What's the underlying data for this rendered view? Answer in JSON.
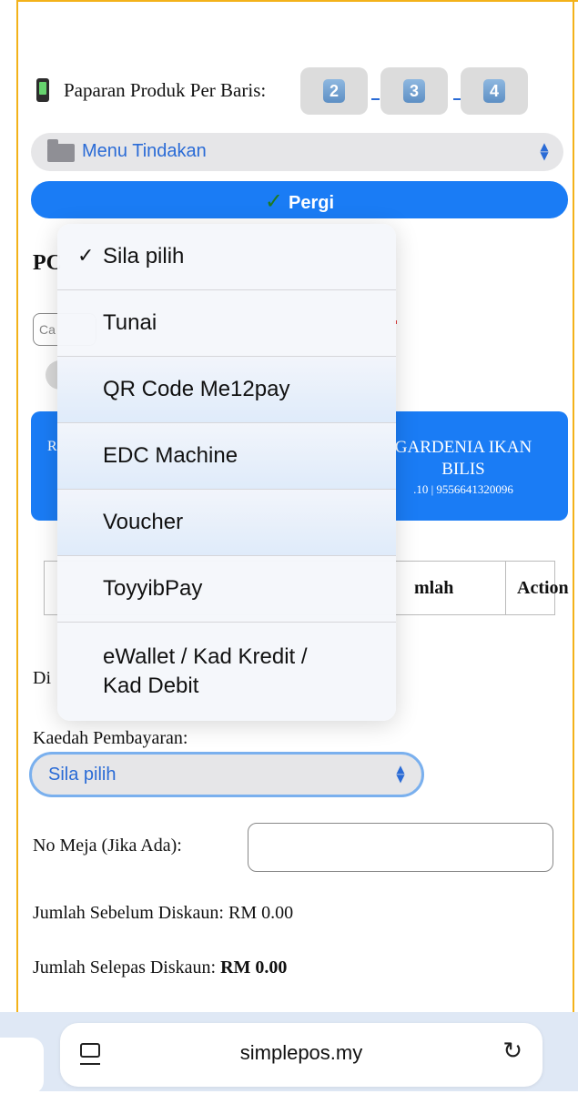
{
  "products_per_row": {
    "label": "Paparan Produk Per Baris:",
    "options": [
      "2",
      "3",
      "4"
    ]
  },
  "menu_select": {
    "value": "Menu Tindakan"
  },
  "go_button": {
    "check": "✓",
    "label": "Pergi"
  },
  "page": {
    "heading_partial": "PC",
    "search_placeholder_partial": "Ca",
    "product_card": {
      "left_partial": "R",
      "name": "GARDENIA IKAN BILIS",
      "price_barcode": ".10 | 9556641320096"
    },
    "table_headers": {
      "jumlah": "mlah",
      "action": "Action"
    },
    "discount_partial": "Di"
  },
  "payment": {
    "label": "Kaedah Pembayaran:",
    "value": "Sila pilih"
  },
  "table_number": {
    "label": "No Meja (Jika Ada):",
    "value": ""
  },
  "totals": {
    "before_label": "Jumlah Sebelum Diskaun: RM 0.00",
    "after_label": "Jumlah Selepas Diskaun:",
    "after_value": "RM 0.00"
  },
  "browser": {
    "url": "simplepos.my"
  },
  "payment_dropdown": {
    "selected_check": "✓",
    "items": [
      "Sila pilih",
      "Tunai",
      "QR Code Me12pay",
      "EDC Machine",
      "Voucher",
      "ToyyibPay",
      "eWallet / Kad Kredit /",
      "Kad Debit"
    ]
  },
  "colors": {
    "accent": "#1a7cf5",
    "frame": "#f3b21a",
    "link": "#2a6bd6"
  }
}
